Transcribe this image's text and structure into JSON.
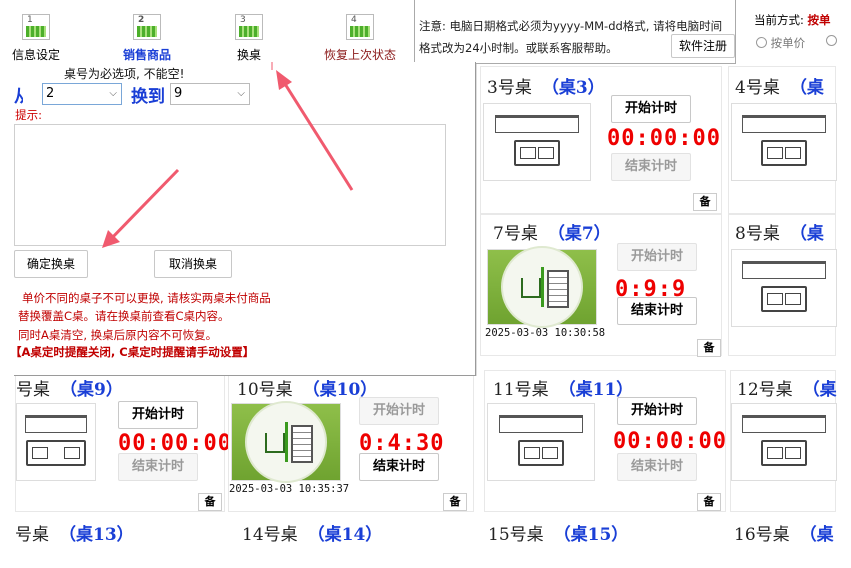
{
  "toolbar": {
    "items": [
      {
        "label": "信息设定",
        "num": "1"
      },
      {
        "label": "销售商品",
        "num": "2"
      },
      {
        "label": "换桌",
        "num": "3"
      },
      {
        "label": "恢复上次状态",
        "num": "4"
      }
    ],
    "notice": "注意: 电脑日期格式必须为yyyy-MM-dd格式, 请将电脑时间格式改为24小时制。或联系客服帮助。",
    "notice_line1": "注意: 电脑日期格式必须为yyyy-MM-dd格式, 请将电脑时间",
    "notice_line2": "格式改为24小时制。或联系客服帮助。",
    "register_label": "软件注册",
    "billing_mode_label": "当前方式:",
    "billing_mode_value": "按单",
    "radio_per_unit": "按单价"
  },
  "switch_dialog": {
    "hint": "桌号为必选项, 不能空!",
    "from_label": "从",
    "from_value": "2",
    "to_label": "换到",
    "to_value": "9",
    "tips_label": "提示:",
    "confirm_label": "确定换桌",
    "cancel_label": "取消换桌",
    "rules": [
      "单价不同的桌子不可以更换, 请核实两桌未付商品",
      "替换覆盖C桌。请在换桌前查看C桌内容。",
      "同时A桌清空, 换桌后原内容不可恢复。",
      "【A桌定时提醒关闭, C桌定时提醒请手动设置】"
    ]
  },
  "buttons": {
    "start": "开始计时",
    "end": "结束计时",
    "note": "备"
  },
  "tables": [
    {
      "id": "t3",
      "name": "3号桌",
      "code": "（桌3）",
      "timer": "00:00:00",
      "busy": false
    },
    {
      "id": "t4",
      "name": "4号桌",
      "code": "（桌",
      "timer": "",
      "busy": false
    },
    {
      "id": "t7",
      "name": "7号桌",
      "code": "（桌7）",
      "timer": "0:9:9",
      "busy": true,
      "stamp": "2025-03-03 10:30:58"
    },
    {
      "id": "t8",
      "name": "8号桌",
      "code": "（桌",
      "timer": "",
      "busy": false
    },
    {
      "id": "t9",
      "name": "号桌",
      "code": "（桌9）",
      "timer": "00:00:00",
      "busy": false
    },
    {
      "id": "t10",
      "name": "10号桌",
      "code": "（桌10）",
      "timer": "0:4:30",
      "busy": true,
      "stamp": "2025-03-03 10:35:37"
    },
    {
      "id": "t11",
      "name": "11号桌",
      "code": "（桌11）",
      "timer": "00:00:00",
      "busy": false
    },
    {
      "id": "t12",
      "name": "12号桌",
      "code": "（桌",
      "timer": "",
      "busy": false
    },
    {
      "id": "t13",
      "name": "号桌",
      "code": "（桌13）"
    },
    {
      "id": "t14",
      "name": "14号桌",
      "code": "（桌14）"
    },
    {
      "id": "t15",
      "name": "15号桌",
      "code": "（桌15）"
    },
    {
      "id": "t16",
      "name": "16号桌",
      "code": "（桌"
    }
  ],
  "colors": {
    "accent_blue": "#1a3fd6",
    "timer_red": "#e00000",
    "rule_red": "#c00000",
    "arrow": "#f05a6e",
    "busy_green": "#6fa330"
  }
}
